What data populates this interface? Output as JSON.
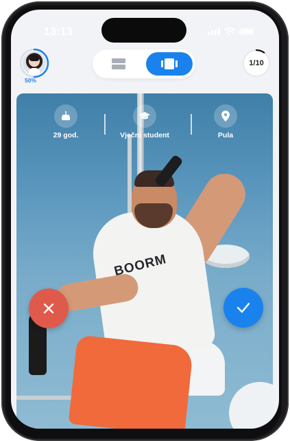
{
  "status_bar": {
    "time": "13:13"
  },
  "header": {
    "profile_progress": "50%",
    "profile_progress_value": 0.5,
    "view_toggle": {
      "options": [
        "list-icon",
        "cards-icon"
      ],
      "active": "cards-icon"
    },
    "counter": "1/10",
    "counter_progress_value": 0.1
  },
  "profile": {
    "stats": [
      {
        "icon": "cake-icon",
        "label": "29 god."
      },
      {
        "icon": "graduation-cap-icon",
        "label": "Vječni student"
      },
      {
        "icon": "location-pin-icon",
        "label": "Pula"
      }
    ],
    "shirt_text": "BOORM"
  },
  "actions": {
    "reject_icon": "close-icon",
    "accept_icon": "check-icon"
  },
  "colors": {
    "accent": "#1a82ec",
    "reject": "#e05a4b",
    "progress": "#2a7de1"
  }
}
